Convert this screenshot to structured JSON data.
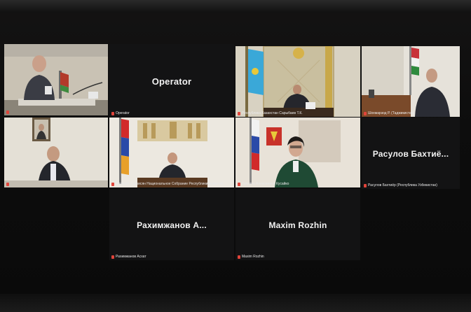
{
  "participants": [
    {
      "caption": "",
      "name": ""
    },
    {
      "caption": "Operator",
      "name": "Operator"
    },
    {
      "caption": "Республика Казахстан Сарыбаев Т.К.",
      "name": ""
    },
    {
      "caption": "Шохмарзод Р. (Таджикистан)",
      "name": ""
    },
    {
      "caption": "",
      "name": ""
    },
    {
      "caption": "Алексей Саркисян Национальное Собрание Республики Армения",
      "name": ""
    },
    {
      "caption": "Татьяна Алексеевна Кусайко",
      "name": ""
    },
    {
      "caption": "Расулов Бахтиёр (Республика Узбекистан)",
      "name": "Расулов  Бахтиё..."
    },
    {
      "caption": "Рахимжанов Асхат",
      "name": "Рахимжанов  А..."
    },
    {
      "caption": "Maxim Rozhin",
      "name": "Maxim Rozhin"
    }
  ],
  "colors": {
    "accent": "#d8d24a",
    "mic": "#e0443a"
  }
}
